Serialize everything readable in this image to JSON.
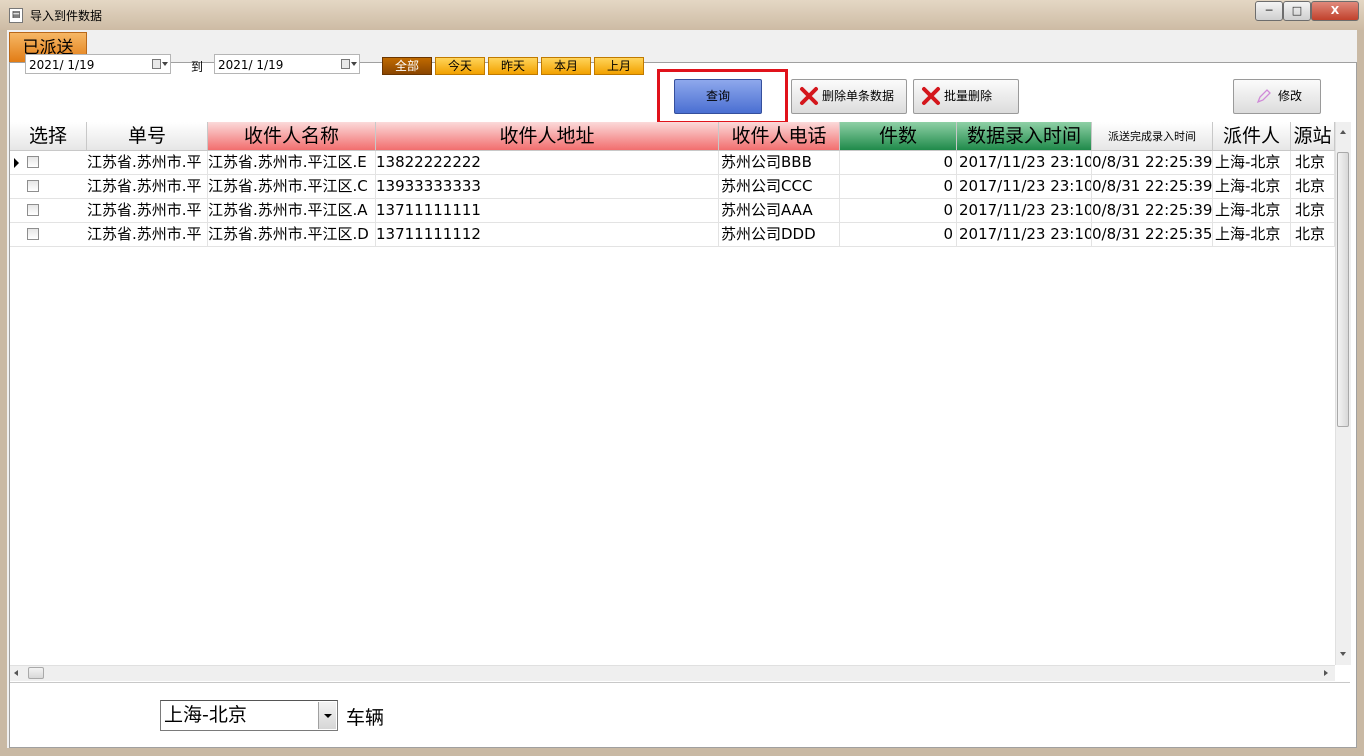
{
  "window": {
    "title": "导入到件数据",
    "min": "─",
    "max": "□",
    "close": "X"
  },
  "tab": {
    "label": "已派送"
  },
  "toolbar": {
    "date_from": "2021/ 1/19",
    "to_label": "到",
    "date_to": "2021/ 1/19",
    "quick": [
      "全部",
      "今天",
      "昨天",
      "本月",
      "上月"
    ],
    "query": "查询",
    "delete_single": "删除单条数据",
    "batch_delete": "批量删除",
    "edit": "修改"
  },
  "grid": {
    "columns": [
      "选择",
      "单号",
      "收件人名称",
      "收件人地址",
      "收件人电话",
      "件数",
      "数据录入时间",
      "派送完成录入时间",
      "派件人",
      "源站"
    ],
    "rows": [
      {
        "c1": "江苏省.苏州市.平",
        "c2": "江苏省.苏州市.平江区.E",
        "c3": "13822222222",
        "c4": "苏州公司BBB",
        "c5": "0",
        "c6": "2017/11/23 23:10",
        "c7": "0/8/31 22:25:39",
        "c8": "上海-北京",
        "c9": "北京"
      },
      {
        "c1": "江苏省.苏州市.平",
        "c2": "江苏省.苏州市.平江区.C",
        "c3": "13933333333",
        "c4": "苏州公司CCC",
        "c5": "0",
        "c6": "2017/11/23 23:10",
        "c7": "0/8/31 22:25:39",
        "c8": "上海-北京",
        "c9": "北京"
      },
      {
        "c1": "江苏省.苏州市.平",
        "c2": "江苏省.苏州市.平江区.A",
        "c3": "13711111111",
        "c4": "苏州公司AAA",
        "c5": "0",
        "c6": "2017/11/23 23:10",
        "c7": "0/8/31 22:25:39",
        "c8": "上海-北京",
        "c9": "北京"
      },
      {
        "c1": "江苏省.苏州市.平",
        "c2": "江苏省.苏州市.平江区.D",
        "c3": "13711111112",
        "c4": "苏州公司DDD",
        "c5": "0",
        "c6": "2017/11/23 23:10",
        "c7": "0/8/31 22:25:35",
        "c8": "上海-北京",
        "c9": "北京"
      }
    ]
  },
  "footer": {
    "route": "上海-北京",
    "vehicle_label": "车辆"
  },
  "colors": {
    "accent_orange": "#f2a100",
    "query_blue": "#4a6fd2",
    "header_red": "#f26e6e",
    "header_green": "#1f8a4a",
    "highlight": "#e0121b"
  }
}
